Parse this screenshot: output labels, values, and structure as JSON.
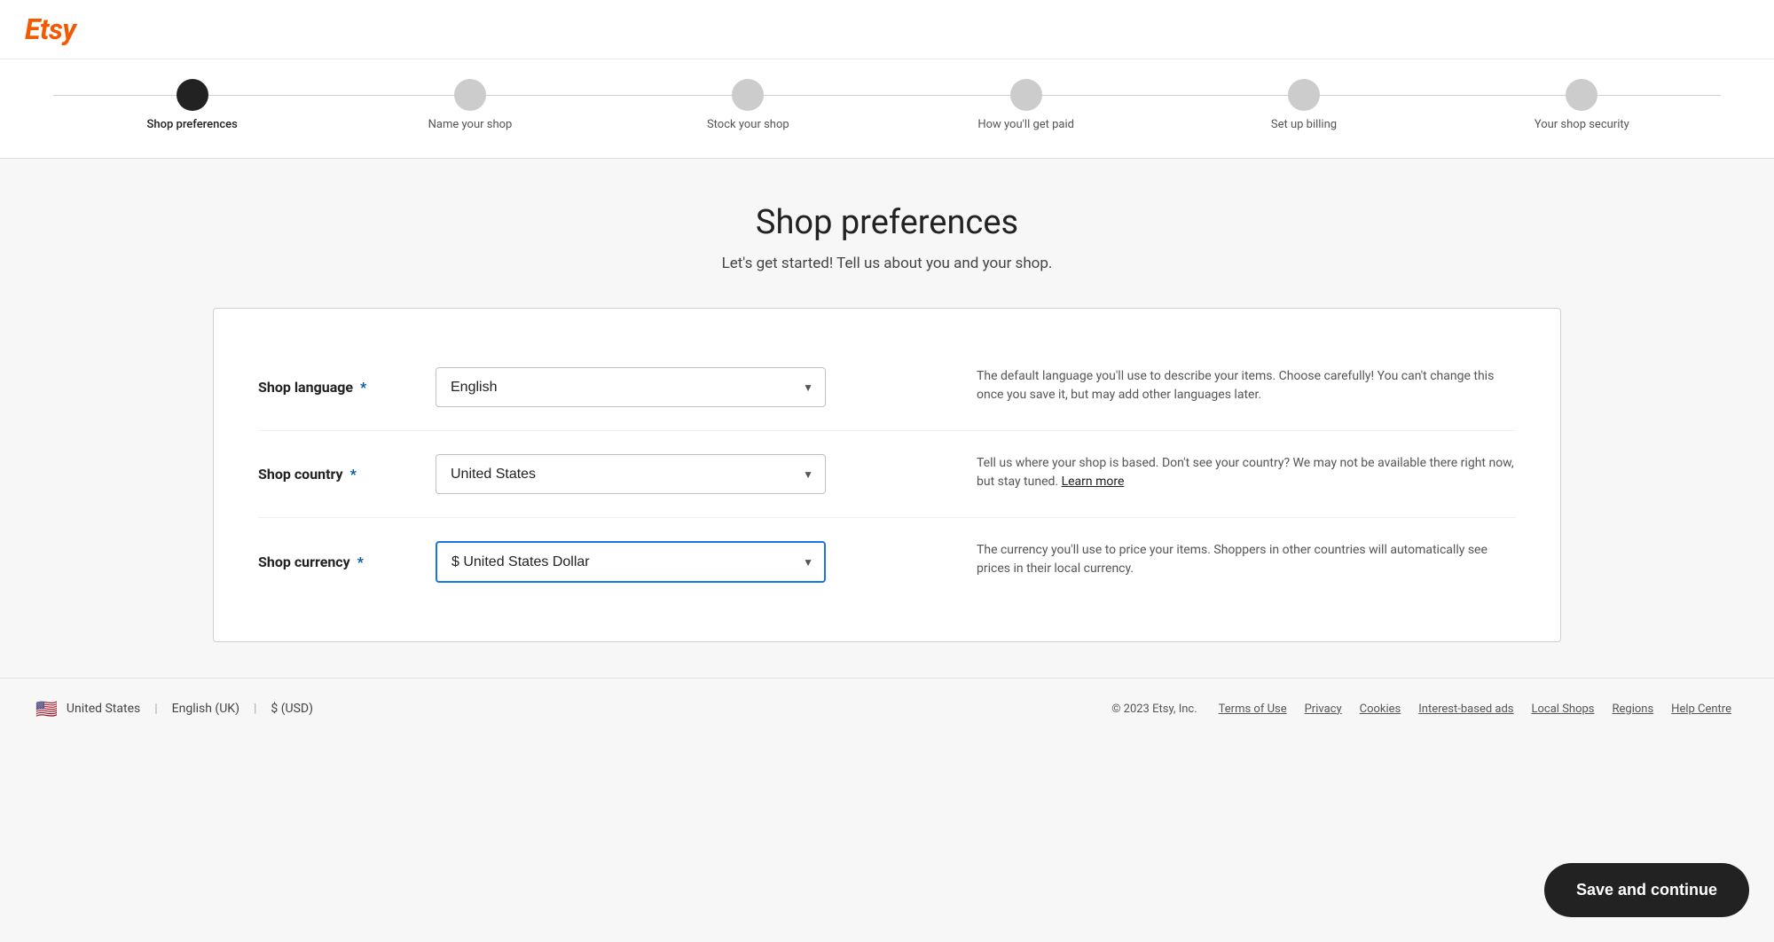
{
  "header": {
    "logo": "Etsy"
  },
  "progress": {
    "steps": [
      {
        "label": "Shop preferences",
        "active": true
      },
      {
        "label": "Name your shop",
        "active": false
      },
      {
        "label": "Stock your shop",
        "active": false
      },
      {
        "label": "How you'll get paid",
        "active": false
      },
      {
        "label": "Set up billing",
        "active": false
      },
      {
        "label": "Your shop security",
        "active": false
      }
    ]
  },
  "page": {
    "title": "Shop preferences",
    "subtitle": "Let's get started! Tell us about you and your shop."
  },
  "form": {
    "rows": [
      {
        "label": "Shop language",
        "required": true,
        "value": "English",
        "hint": "The default language you'll use to describe your items. Choose carefully! You can't change this once you save it, but may add other languages later.",
        "hint_link": null,
        "active": false
      },
      {
        "label": "Shop country",
        "required": true,
        "value": "United States",
        "hint": "Tell us where your shop is based. Don't see your country? We may not be available there right now, but stay tuned.",
        "hint_link": "Learn more",
        "active": false
      },
      {
        "label": "Shop currency",
        "required": true,
        "value": "$ United States Dollar",
        "hint": "The currency you'll use to price your items. Shoppers in other countries will automatically see prices in their local currency.",
        "hint_link": null,
        "active": true
      }
    ]
  },
  "footer": {
    "flag": "🇺🇸",
    "locale": "United States",
    "divider1": "|",
    "language": "English (UK)",
    "divider2": "|",
    "currency": "$ (USD)",
    "copyright": "© 2023 Etsy, Inc.",
    "links": [
      "Terms of Use",
      "Privacy",
      "Cookies",
      "Interest-based ads",
      "Local Shops",
      "Regions",
      "Help Centre"
    ]
  },
  "buttons": {
    "save_continue": "Save and continue"
  }
}
